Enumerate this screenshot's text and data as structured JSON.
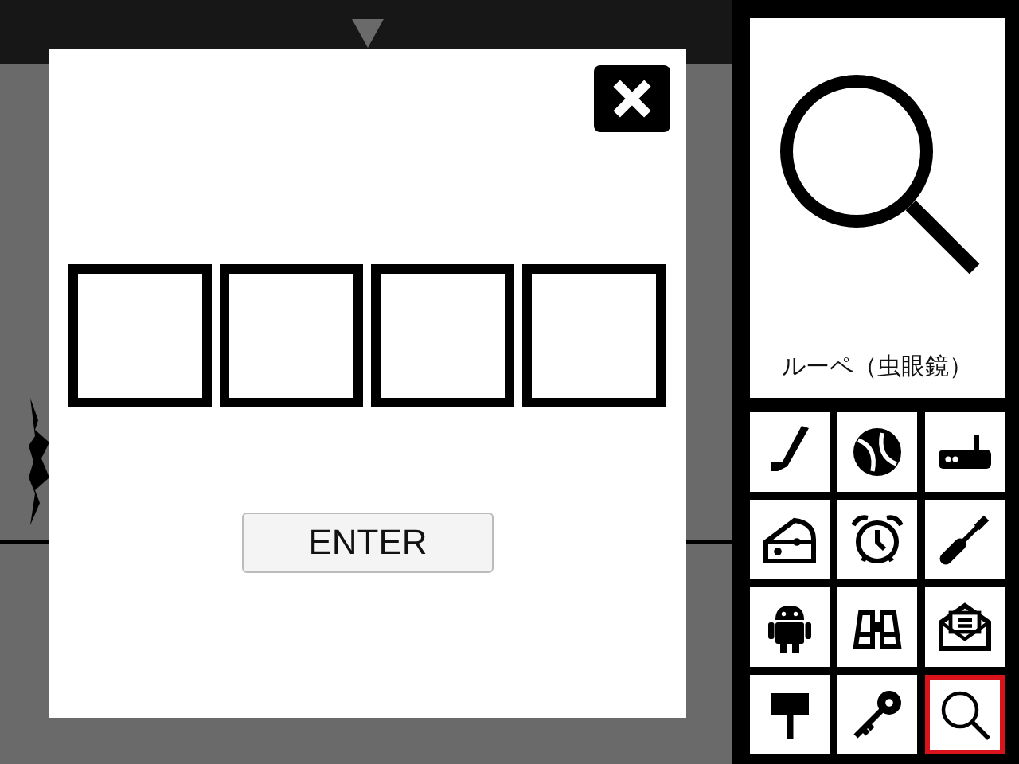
{
  "code_dialog": {
    "digit_fields": [
      {
        "kind": "digit"
      },
      {
        "kind": "digit"
      },
      {
        "kind": "digit"
      },
      {
        "kind": "digit"
      }
    ],
    "enter_button": "ENTER"
  },
  "preview": {
    "kind": "magnifier",
    "label": "ルーペ（虫眼鏡）"
  },
  "inventory": [
    {
      "kind": "hockey-stick",
      "selected": false
    },
    {
      "kind": "ball",
      "selected": false
    },
    {
      "kind": "router",
      "selected": false
    },
    {
      "kind": "cheese",
      "selected": false
    },
    {
      "kind": "alarm-clock",
      "selected": false
    },
    {
      "kind": "screwdriver",
      "selected": false
    },
    {
      "kind": "robot",
      "selected": false
    },
    {
      "kind": "binoculars",
      "selected": false
    },
    {
      "kind": "mail",
      "selected": false
    },
    {
      "kind": "mallet",
      "selected": false
    },
    {
      "kind": "key",
      "selected": false
    },
    {
      "kind": "magnifier",
      "selected": true
    }
  ]
}
